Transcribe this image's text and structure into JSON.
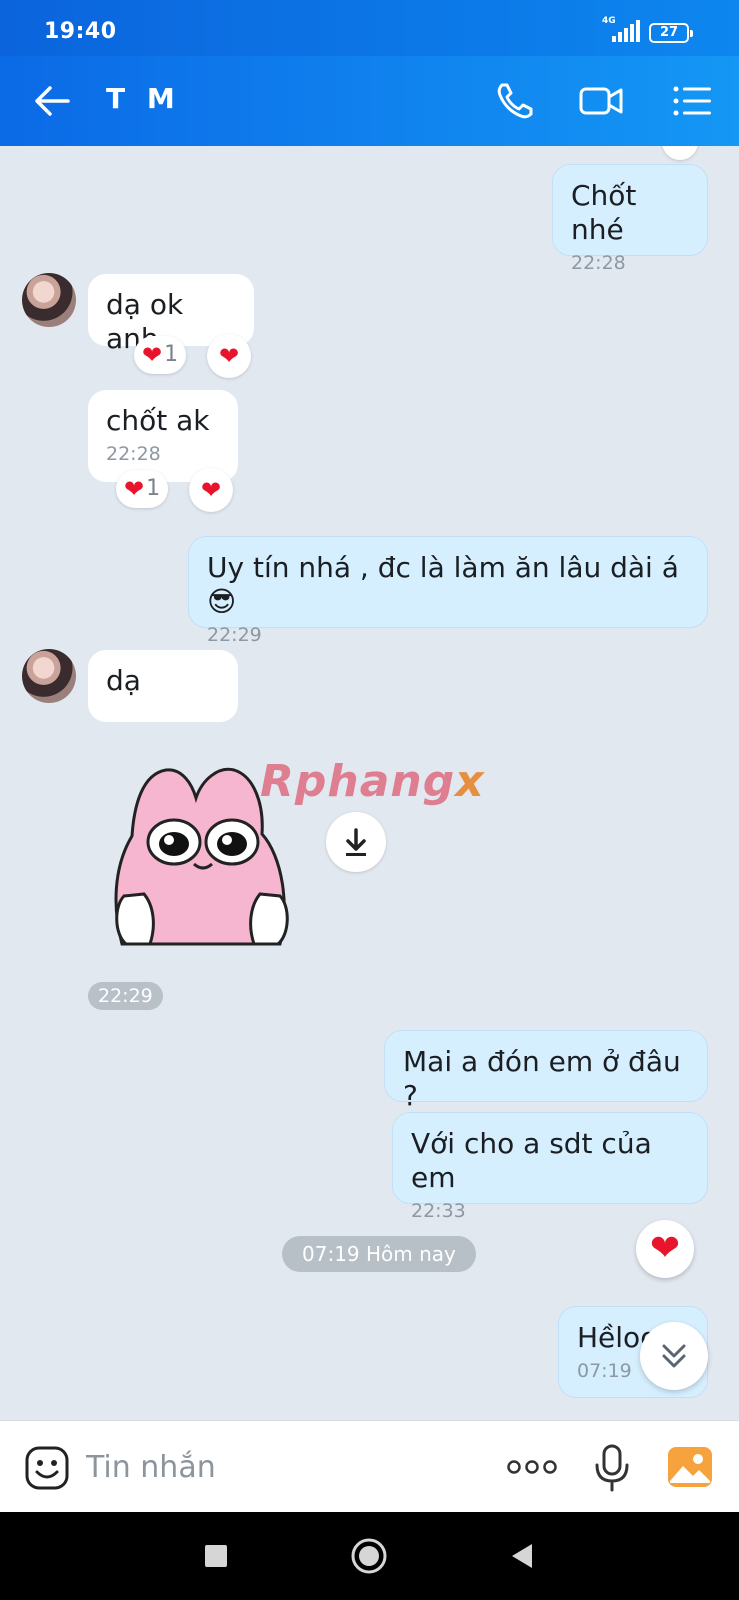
{
  "status_bar": {
    "time": "19:40",
    "network": "4G",
    "battery": "27"
  },
  "header": {
    "title": "T M",
    "icons": [
      "back-arrow-icon",
      "phone-icon",
      "video-call-icon",
      "menu-list-icon"
    ]
  },
  "messages": [
    {
      "direction": "out",
      "text": "Chốt nhé",
      "time": "22:28"
    },
    {
      "direction": "in",
      "text": "dạ ok anh",
      "reaction_count": "1"
    },
    {
      "direction": "in",
      "text": "chốt ak",
      "time": "22:28",
      "reaction_count": "1"
    },
    {
      "direction": "out",
      "text": "Uy tín nhá , đc là làm ăn lâu dài á 😎",
      "time": "22:29"
    },
    {
      "direction": "in",
      "text": "dạ"
    },
    {
      "direction": "in",
      "type": "sticker",
      "time": "22:29"
    },
    {
      "direction": "out",
      "text": "Mai a đón em ở đâu ?"
    },
    {
      "direction": "out",
      "text": "Với cho a sdt của em",
      "time": "22:33"
    },
    {
      "direction": "out",
      "text": "Hềloo",
      "time": "07:19"
    }
  ],
  "date_separator": "07:19 Hôm nay",
  "watermark": {
    "main": "Rphang",
    "tail": "x"
  },
  "input": {
    "placeholder": "Tin nhắn"
  },
  "colors": {
    "header": "#0b6ae6",
    "outgoing_bubble": "#d6efff",
    "background": "#e2e8f0",
    "heart": "#e8142b"
  }
}
